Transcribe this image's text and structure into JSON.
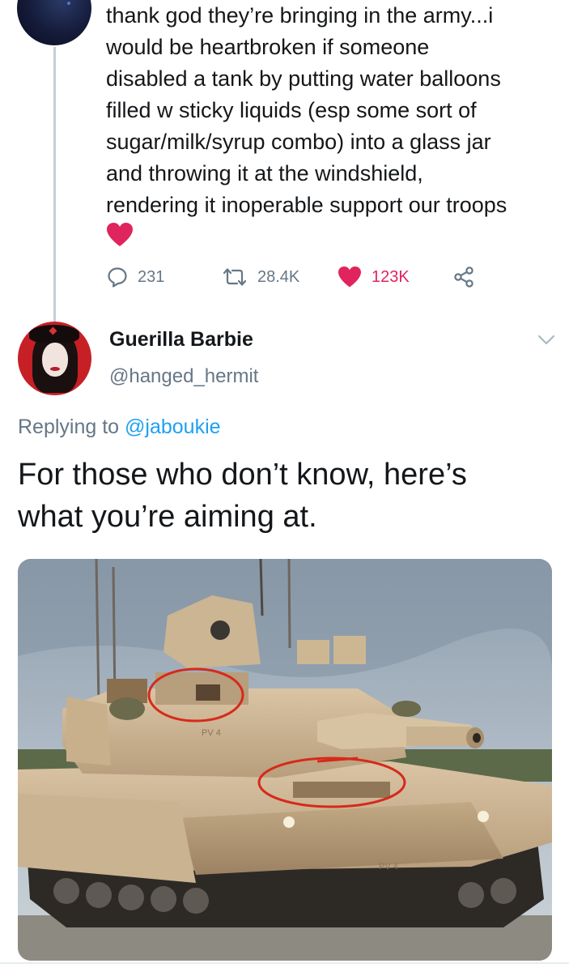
{
  "prev_tweet": {
    "text": "thank god they’re bringing in the army...i\nwould be heartbroken if someone\ndisabled a tank by putting water balloons\nfilled w sticky liquids (esp some sort of\nsugar/milk/syrup combo) into a glass jar\nand throwing it at the windshield,\nrendering it inoperable support our troops",
    "emoji": "red-heart",
    "actions": {
      "reply_count": "231",
      "retweet_count": "28.4K",
      "like_count": "123K"
    }
  },
  "reply_tweet": {
    "display_name": "Guerilla Barbie",
    "handle": "@hanged_hermit",
    "replying_prefix": "Replying to ",
    "replying_mention": "@jaboukie",
    "text": "For those who don’t know, here’s\nwhat you’re aiming at.",
    "image_markings": {
      "upper_plate": "PV 4",
      "hull_plate": "PV 4"
    }
  },
  "colors": {
    "text": "#14171a",
    "secondary": "#657786",
    "like": "#e0245e",
    "link": "#1da1f2",
    "thread_line": "#c4cfd6",
    "annotation": "#d62a1a"
  },
  "icons": [
    "reply-icon",
    "retweet-icon",
    "like-icon",
    "share-icon",
    "chevron-down-icon"
  ]
}
